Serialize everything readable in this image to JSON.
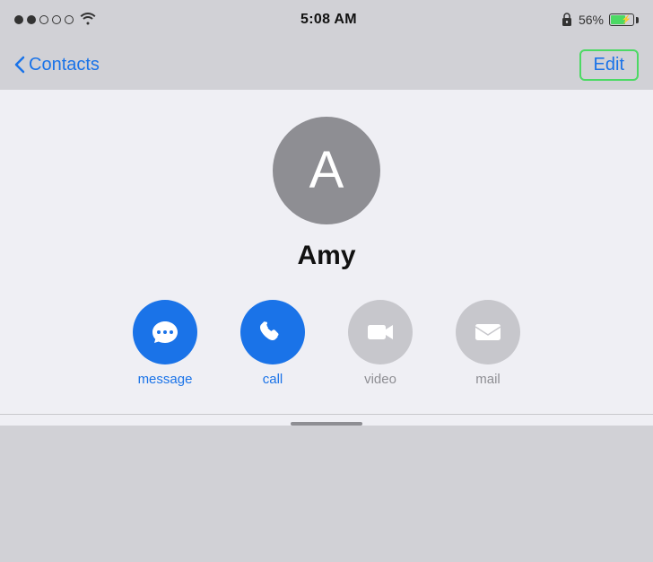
{
  "status_bar": {
    "time": "5:08 AM",
    "battery_percent": "56%"
  },
  "nav": {
    "back_label": "Contacts",
    "edit_label": "Edit"
  },
  "contact": {
    "name": "Amy",
    "avatar_letter": "A"
  },
  "actions": [
    {
      "id": "message",
      "label": "message",
      "icon_type": "blue",
      "icon": "message"
    },
    {
      "id": "call",
      "label": "call",
      "icon_type": "blue",
      "icon": "phone"
    },
    {
      "id": "video",
      "label": "video",
      "icon_type": "gray",
      "icon": "video"
    },
    {
      "id": "mail",
      "label": "mail",
      "icon_type": "gray",
      "icon": "mail"
    }
  ]
}
